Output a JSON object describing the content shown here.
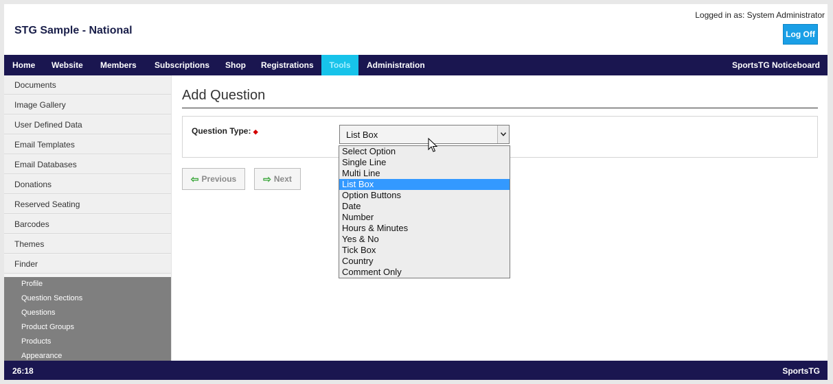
{
  "header": {
    "site_title": "STG Sample - National",
    "logged_in": "Logged in as: System Administrator",
    "logoff_label": "Log Off"
  },
  "nav": {
    "items": [
      "Home",
      "Website",
      "Members",
      "Subscriptions",
      "Shop",
      "Registrations",
      "Tools",
      "Administration"
    ],
    "active": "Tools",
    "right_label": "SportsTG Noticeboard"
  },
  "sidebar": {
    "items": [
      "Documents",
      "Image Gallery",
      "User Defined Data",
      "Email Templates",
      "Email Databases",
      "Donations",
      "Reserved Seating",
      "Barcodes",
      "Themes",
      "Finder"
    ],
    "sub_items": [
      "Profile",
      "Question Sections",
      "Questions",
      "Product Groups",
      "Products",
      "Appearance"
    ]
  },
  "main": {
    "title": "Add Question",
    "question_type_label": "Question Type:",
    "required_marker": "◆",
    "select_value": "List Box",
    "options": [
      "Select Option",
      "Single Line",
      "Multi Line",
      "List Box",
      "Option Buttons",
      "Date",
      "Number",
      "Hours & Minutes",
      "Yes & No",
      "Tick Box",
      "Country",
      "Comment Only"
    ],
    "selected_option": "List Box",
    "previous_label": "Previous",
    "next_label": "Next"
  },
  "footer": {
    "left": "26:18",
    "right": "SportsTG"
  },
  "colors": {
    "nav_bg": "#1a1650",
    "active_tab": "#17c3ea",
    "logoff_bg": "#1a9fe6",
    "option_highlight": "#3399ff",
    "subpanel_bg": "#7f7f7f"
  }
}
